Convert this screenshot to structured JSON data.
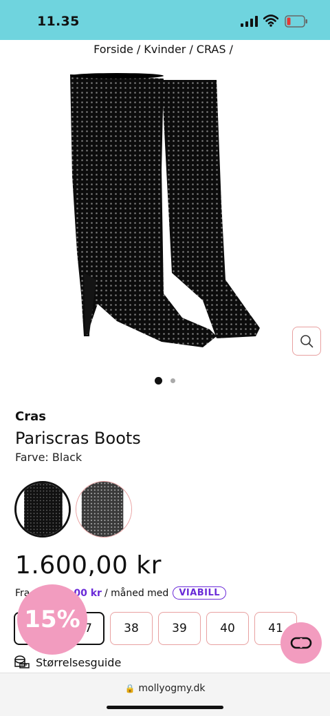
{
  "status_bar": {
    "time": "11.35"
  },
  "breadcrumb": {
    "items": [
      "Forside",
      "Kvinder",
      "CRAS"
    ],
    "separator": "/"
  },
  "product": {
    "brand": "Cras",
    "name": "Pariscras Boots",
    "color_text": "Farve: Black",
    "price": "1.600,00 kr",
    "image_slides": 2,
    "active_slide": 1
  },
  "financing": {
    "prefix": "Fra",
    "monthly_amount": "00 kr",
    "suffix": "/ måned med",
    "provider": "VIABILL"
  },
  "sizes": {
    "items": [
      "7",
      "38",
      "39",
      "40",
      "41"
    ],
    "selected": "7"
  },
  "discount_badge": "15%",
  "size_guide_label": "Størrelsesguide",
  "browser": {
    "url": "mollyogmy.dk"
  },
  "colors": {
    "status_bar": "#6fd4de",
    "accent_pink": "#f29cbf",
    "viabill_purple": "#6a2ad8",
    "border_pink": "#e8a0a0"
  },
  "icons": [
    "signal-icon",
    "wifi-icon",
    "battery-low-icon",
    "zoom-icon",
    "chat-icon",
    "size-guide-icon",
    "lock-icon"
  ]
}
